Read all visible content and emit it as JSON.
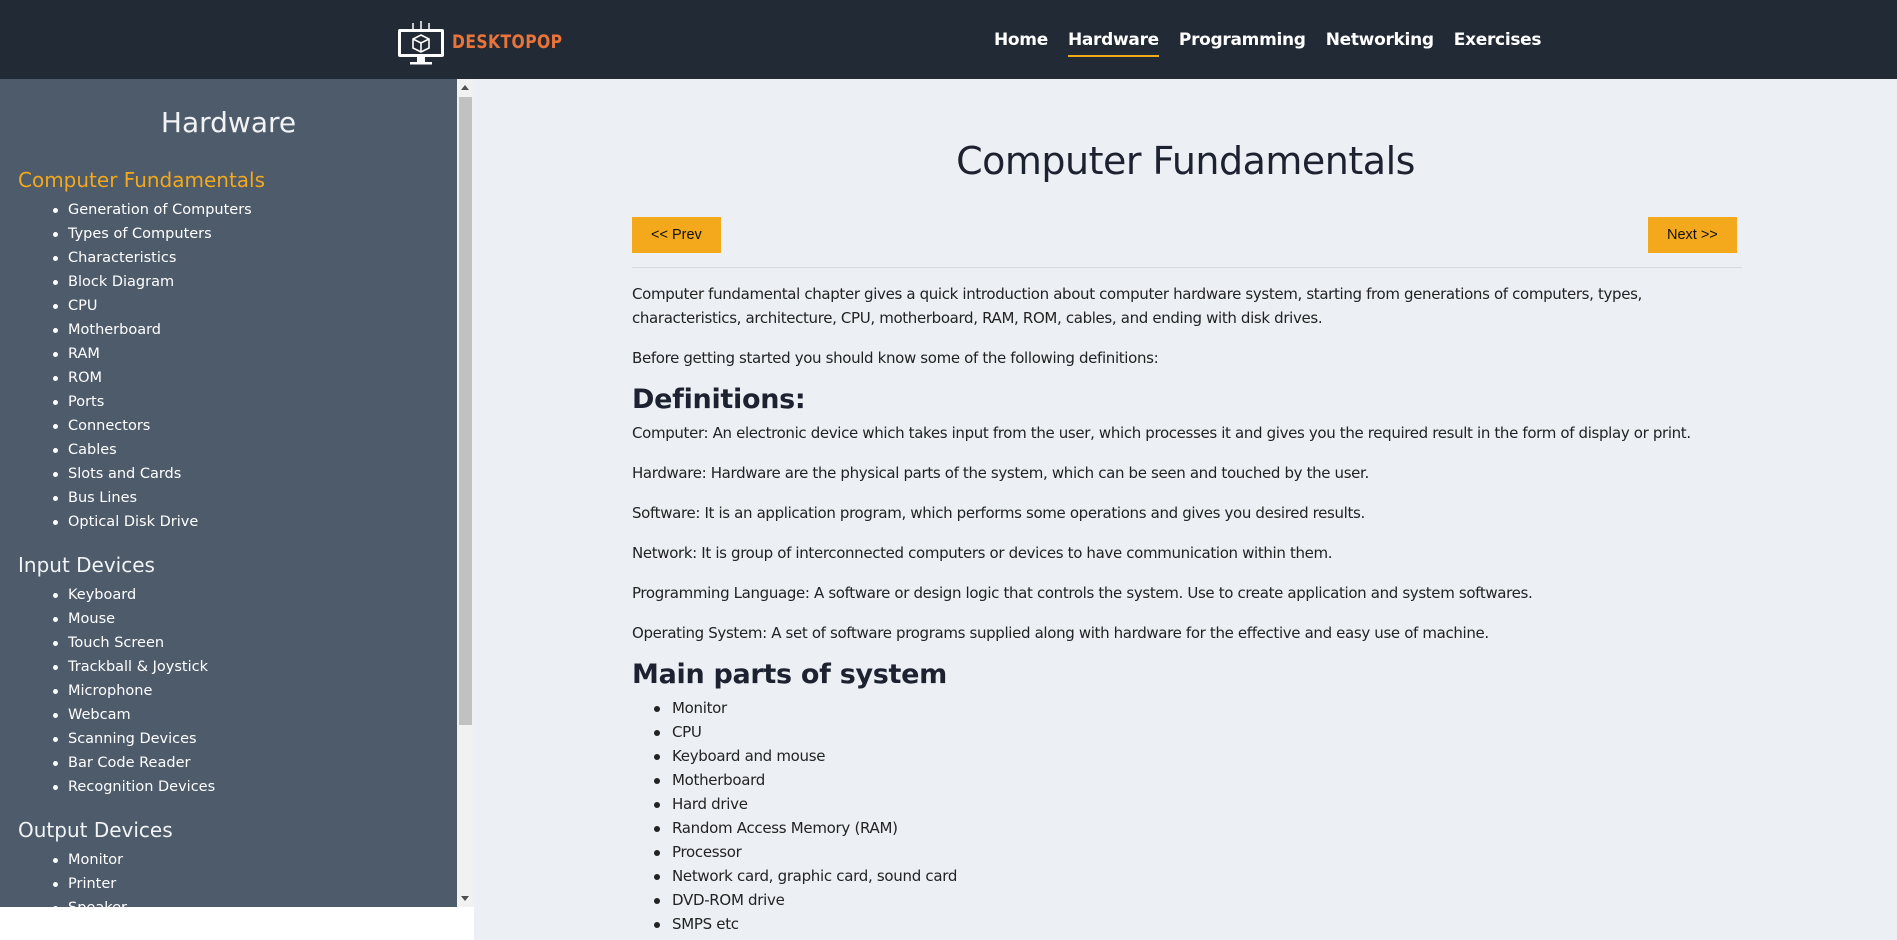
{
  "header": {
    "logo_text": "DESKTOPOP",
    "nav": [
      {
        "label": "Home",
        "active": false
      },
      {
        "label": "Hardware",
        "active": true
      },
      {
        "label": "Programming",
        "active": false
      },
      {
        "label": "Networking",
        "active": false
      },
      {
        "label": "Exercises",
        "active": false
      }
    ]
  },
  "sidebar": {
    "title": "Hardware",
    "sections": [
      {
        "heading": "Computer Fundamentals",
        "active": true,
        "items": [
          "Generation of Computers",
          "Types of Computers",
          "Characteristics",
          "Block Diagram",
          "CPU",
          "Motherboard",
          "RAM",
          "ROM",
          "Ports",
          "Connectors",
          "Cables",
          "Slots and Cards",
          "Bus Lines",
          "Optical Disk Drive"
        ]
      },
      {
        "heading": "Input Devices",
        "active": false,
        "items": [
          "Keyboard",
          "Mouse",
          "Touch Screen",
          "Trackball & Joystick",
          "Microphone",
          "Webcam",
          "Scanning Devices",
          "Bar Code Reader",
          "Recognition Devices"
        ]
      },
      {
        "heading": "Output Devices",
        "active": false,
        "items": [
          "Monitor",
          "Printer",
          "Speaker"
        ]
      }
    ]
  },
  "main": {
    "title": "Computer Fundamentals",
    "prev_label": "<< Prev",
    "next_label": "Next >>",
    "intro": "Computer fundamental chapter gives a quick introduction about computer hardware system, starting from generations of computers, types, characteristics, architecture, CPU, motherboard, RAM, ROM, cables, and ending with disk drives.",
    "before": "Before getting started you should know some of the following definitions:",
    "definitions_heading": "Definitions:",
    "definitions": [
      "Computer: An electronic device which takes input from the user, which processes it and gives you the required result in the form of display or print.",
      "Hardware: Hardware are the physical parts of the system, which can be seen and touched by the user.",
      "Software: It is an application program, which performs some operations and gives you desired results.",
      "Network: It is group of interconnected computers or devices to have communication within them.",
      "Programming Language: A software or design logic that controls the system. Use to create application and system softwares.",
      "Operating System: A set of software programs supplied along with hardware for the effective and easy use of machine."
    ],
    "parts_heading": "Main parts of system",
    "parts": [
      "Monitor",
      "CPU",
      "Keyboard and mouse",
      "Motherboard",
      "Hard drive",
      "Random Access Memory (RAM)",
      "Processor",
      "Network card, graphic card, sound card",
      "DVD-ROM drive",
      "SMPS etc"
    ]
  }
}
